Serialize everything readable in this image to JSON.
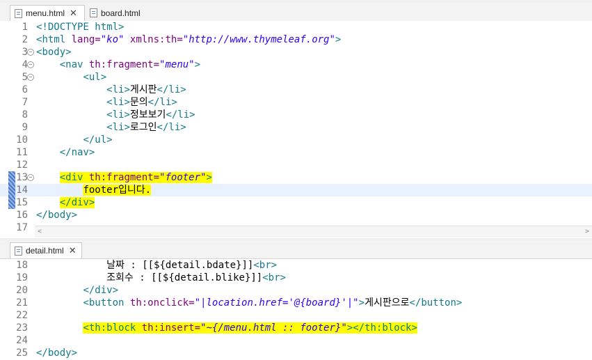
{
  "top_tabs": [
    {
      "label": "menu.html",
      "active": true,
      "close": "✕"
    },
    {
      "label": "board.html",
      "active": false
    }
  ],
  "bottom_tabs": [
    {
      "label": "detail.html",
      "active": true,
      "close": "✕"
    }
  ],
  "menu_lines": [
    {
      "n": "1",
      "tokens": [
        [
          "br",
          "<!"
        ],
        [
          "tag",
          "DOCTYPE html"
        ],
        [
          "br",
          ">"
        ]
      ]
    },
    {
      "n": "2",
      "tokens": [
        [
          "br",
          "<"
        ],
        [
          "tag",
          "html "
        ],
        [
          "attr",
          "lang="
        ],
        [
          "val",
          "\"ko\""
        ],
        [
          "attr",
          " xmlns:th="
        ],
        [
          "val",
          "\"http://www.thymeleaf.org\""
        ],
        [
          "br",
          ">"
        ]
      ]
    },
    {
      "n": "3",
      "fold": "−",
      "tokens": [
        [
          "br",
          "<"
        ],
        [
          "tag",
          "body"
        ],
        [
          "br",
          ">"
        ]
      ]
    },
    {
      "n": "4",
      "fold": "−",
      "tokens": [
        [
          "txt",
          "    "
        ],
        [
          "br",
          "<"
        ],
        [
          "tag",
          "nav "
        ],
        [
          "attr",
          "th:fragment="
        ],
        [
          "val",
          "\"menu\""
        ],
        [
          "br",
          ">"
        ]
      ]
    },
    {
      "n": "5",
      "fold": "−",
      "tokens": [
        [
          "txt",
          "        "
        ],
        [
          "br",
          "<"
        ],
        [
          "tag",
          "ul"
        ],
        [
          "br",
          ">"
        ]
      ]
    },
    {
      "n": "6",
      "tokens": [
        [
          "txt",
          "            "
        ],
        [
          "br",
          "<"
        ],
        [
          "tag",
          "li"
        ],
        [
          "br",
          ">"
        ],
        [
          "txt",
          "게시판"
        ],
        [
          "br",
          "</"
        ],
        [
          "tag",
          "li"
        ],
        [
          "br",
          ">"
        ]
      ]
    },
    {
      "n": "7",
      "tokens": [
        [
          "txt",
          "            "
        ],
        [
          "br",
          "<"
        ],
        [
          "tag",
          "li"
        ],
        [
          "br",
          ">"
        ],
        [
          "txt",
          "문의"
        ],
        [
          "br",
          "</"
        ],
        [
          "tag",
          "li"
        ],
        [
          "br",
          ">"
        ]
      ]
    },
    {
      "n": "8",
      "tokens": [
        [
          "txt",
          "            "
        ],
        [
          "br",
          "<"
        ],
        [
          "tag",
          "li"
        ],
        [
          "br",
          ">"
        ],
        [
          "txt",
          "정보보기"
        ],
        [
          "br",
          "</"
        ],
        [
          "tag",
          "li"
        ],
        [
          "br",
          ">"
        ]
      ]
    },
    {
      "n": "9",
      "tokens": [
        [
          "txt",
          "            "
        ],
        [
          "br",
          "<"
        ],
        [
          "tag",
          "li"
        ],
        [
          "br",
          ">"
        ],
        [
          "txt",
          "로그인"
        ],
        [
          "br",
          "</"
        ],
        [
          "tag",
          "li"
        ],
        [
          "br",
          ">"
        ]
      ]
    },
    {
      "n": "10",
      "tokens": [
        [
          "txt",
          "        "
        ],
        [
          "br",
          "</"
        ],
        [
          "tag",
          "ul"
        ],
        [
          "br",
          ">"
        ]
      ]
    },
    {
      "n": "11",
      "tokens": [
        [
          "txt",
          "    "
        ],
        [
          "br",
          "</"
        ],
        [
          "tag",
          "nav"
        ],
        [
          "br",
          ">"
        ]
      ]
    },
    {
      "n": "12",
      "tokens": []
    },
    {
      "n": "13",
      "fold": "−",
      "mark": true,
      "tokens": [
        [
          "txt",
          "    "
        ],
        [
          "hl:br",
          "<"
        ],
        [
          "hl:tag",
          "div "
        ],
        [
          "hl:attr",
          "th:fragment="
        ],
        [
          "hl:val",
          "\"footer\""
        ],
        [
          "hl:br",
          ">"
        ]
      ]
    },
    {
      "n": "14",
      "mark": true,
      "current": true,
      "tokens": [
        [
          "txt",
          "        "
        ],
        [
          "hl:txt",
          "footer입니다."
        ]
      ]
    },
    {
      "n": "15",
      "mark": true,
      "tokens": [
        [
          "txt",
          "    "
        ],
        [
          "hl:br",
          "</"
        ],
        [
          "hl:tag",
          "div"
        ],
        [
          "hl:br",
          ">"
        ]
      ]
    },
    {
      "n": "16",
      "tokens": [
        [
          "br",
          "</"
        ],
        [
          "tag",
          "body"
        ],
        [
          "br",
          ">"
        ]
      ]
    },
    {
      "n": "17",
      "tokens": []
    }
  ],
  "detail_lines": [
    {
      "n": "18",
      "tokens": [
        [
          "txt",
          "            날짜 : [[${detail.bdate}]]"
        ],
        [
          "br",
          "<"
        ],
        [
          "tag",
          "br"
        ],
        [
          "br",
          ">"
        ]
      ]
    },
    {
      "n": "19",
      "tokens": [
        [
          "txt",
          "            조회수 : [[${detail.blike}]]"
        ],
        [
          "br",
          "<"
        ],
        [
          "tag",
          "br"
        ],
        [
          "br",
          ">"
        ]
      ]
    },
    {
      "n": "20",
      "tokens": [
        [
          "txt",
          "        "
        ],
        [
          "br",
          "</"
        ],
        [
          "tag",
          "div"
        ],
        [
          "br",
          ">"
        ]
      ]
    },
    {
      "n": "21",
      "tokens": [
        [
          "txt",
          "        "
        ],
        [
          "br",
          "<"
        ],
        [
          "tag",
          "button "
        ],
        [
          "attr",
          "th:onclick="
        ],
        [
          "val",
          "\"|location.href='@{board}'|\""
        ],
        [
          "br",
          ">"
        ],
        [
          "txt",
          "게시판으로"
        ],
        [
          "br",
          "</"
        ],
        [
          "tag",
          "button"
        ],
        [
          "br",
          ">"
        ]
      ]
    },
    {
      "n": "22",
      "tokens": []
    },
    {
      "n": "23",
      "tokens": [
        [
          "txt",
          "        "
        ],
        [
          "hl:br",
          "<"
        ],
        [
          "hl:tag",
          "th:block "
        ],
        [
          "hl:attr",
          "th:insert="
        ],
        [
          "hl:val",
          "\"~{/menu.html :: footer}\""
        ],
        [
          "hl:br",
          ">"
        ],
        [
          "hl:br",
          "</"
        ],
        [
          "hl:tag",
          "th:block"
        ],
        [
          "hl:br",
          ">"
        ]
      ]
    },
    {
      "n": "24",
      "tokens": []
    },
    {
      "n": "25",
      "tokens": [
        [
          "br",
          "</"
        ],
        [
          "tag",
          "body"
        ],
        [
          "br",
          ">"
        ]
      ]
    }
  ],
  "scrollbar": {
    "left_arrow": "<",
    "right_arrow": ">"
  }
}
